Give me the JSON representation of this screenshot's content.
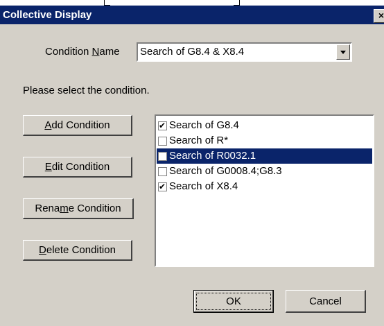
{
  "window": {
    "title": "Collective Display",
    "close_glyph": "×"
  },
  "condition_name": {
    "label_pre": "Condition ",
    "label_underlined": "N",
    "label_post": "ame",
    "selected_value": "Search of G8.4 & X8.4"
  },
  "instruction": "Please select the condition.",
  "buttons": {
    "add": {
      "pre": "",
      "u": "A",
      "post": "dd Condition"
    },
    "edit": {
      "pre": "",
      "u": "E",
      "post": "dit Condition"
    },
    "rename": {
      "pre": "Rena",
      "u": "m",
      "post": "e Condition"
    },
    "delete": {
      "pre": "",
      "u": "D",
      "post": "elete Condition"
    },
    "ok": "OK",
    "cancel": "Cancel"
  },
  "conditions": [
    {
      "label": "Search of G8.4",
      "checked": true,
      "selected": false
    },
    {
      "label": "Search of R*",
      "checked": false,
      "selected": false
    },
    {
      "label": "Search of R0032.1",
      "checked": false,
      "selected": true
    },
    {
      "label": "Search of G0008.4;G8.3",
      "checked": false,
      "selected": false
    },
    {
      "label": "Search of X8.4",
      "checked": true,
      "selected": false
    }
  ],
  "colors": {
    "title_bar": "#0a246a",
    "dialog_bg": "#d4d0c8",
    "selection": "#0a246a"
  },
  "icons": [
    "close-icon",
    "dropdown-arrow-icon",
    "checkbox-icon"
  ]
}
